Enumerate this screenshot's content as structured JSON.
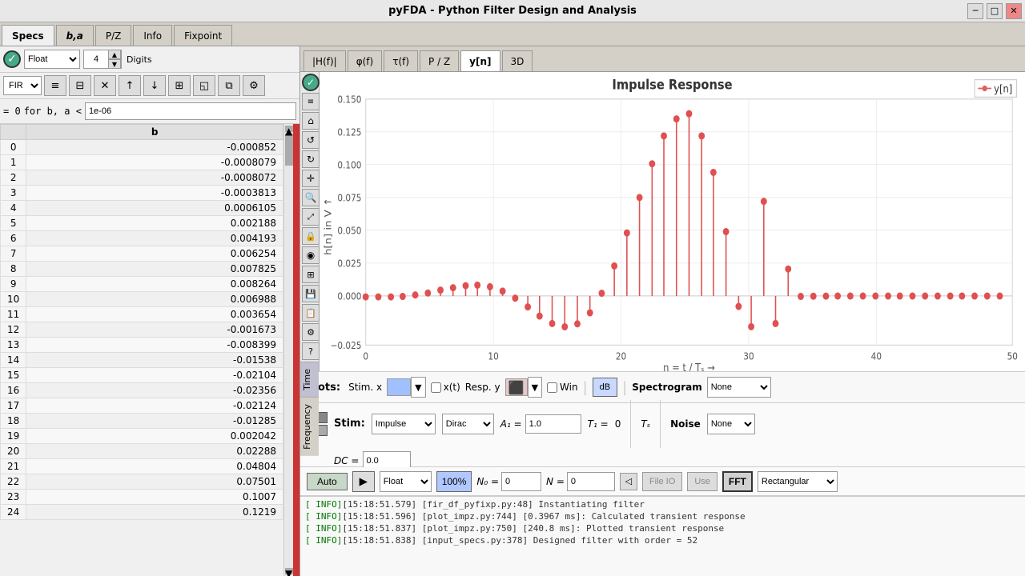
{
  "titlebar": {
    "title": "pyFDA - Python Filter Design and Analysis",
    "controls": [
      "minimize",
      "maximize",
      "close"
    ]
  },
  "top_tabs": [
    {
      "label": "Specs",
      "active": true,
      "bold": false
    },
    {
      "label": "b,a",
      "active": false,
      "bold": true
    },
    {
      "label": "P/Z",
      "active": false,
      "bold": false
    },
    {
      "label": "Info",
      "active": false,
      "bold": false
    },
    {
      "label": "Fixpoint",
      "active": false,
      "bold": false
    }
  ],
  "toolbar": {
    "float_label": "Float",
    "digits_value": "4",
    "digits_label": "Digits",
    "filter_type": "FIR"
  },
  "filter_expr": {
    "prefix": "= 0",
    "for_label": "for b, a <",
    "threshold": "1e-06"
  },
  "coeff_table": {
    "col_b": "b",
    "rows": [
      {
        "idx": 0,
        "b": "-0.000852"
      },
      {
        "idx": 1,
        "b": "-0.0008079"
      },
      {
        "idx": 2,
        "b": "-0.0008072"
      },
      {
        "idx": 3,
        "b": "-0.0003813"
      },
      {
        "idx": 4,
        "b": "0.0006105"
      },
      {
        "idx": 5,
        "b": "0.002188"
      },
      {
        "idx": 6,
        "b": "0.004193"
      },
      {
        "idx": 7,
        "b": "0.006254"
      },
      {
        "idx": 8,
        "b": "0.007825"
      },
      {
        "idx": 9,
        "b": "0.008264"
      },
      {
        "idx": 10,
        "b": "0.006988"
      },
      {
        "idx": 11,
        "b": "0.003654"
      },
      {
        "idx": 12,
        "b": "-0.001673"
      },
      {
        "idx": 13,
        "b": "-0.008399"
      },
      {
        "idx": 14,
        "b": "-0.01538"
      },
      {
        "idx": 15,
        "b": "-0.02104"
      },
      {
        "idx": 16,
        "b": "-0.02356"
      },
      {
        "idx": 17,
        "b": "-0.02124"
      },
      {
        "idx": 18,
        "b": "-0.01285"
      },
      {
        "idx": 19,
        "b": "0.002042"
      },
      {
        "idx": 20,
        "b": "0.02288"
      },
      {
        "idx": 21,
        "b": "0.04804"
      },
      {
        "idx": 22,
        "b": "0.07501"
      },
      {
        "idx": 23,
        "b": "0.1007"
      },
      {
        "idx": 24,
        "b": "0.1219"
      }
    ]
  },
  "plot_tabs": [
    {
      "label": "|H(f)|",
      "active": false
    },
    {
      "label": "φ(f)",
      "active": false
    },
    {
      "label": "τ(f)",
      "active": false
    },
    {
      "label": "P / Z",
      "active": false
    },
    {
      "label": "y[n]",
      "active": true
    },
    {
      "label": "3D",
      "active": false
    }
  ],
  "side_buttons": [
    {
      "label": "Time",
      "active": true
    },
    {
      "label": "Frequency",
      "active": false
    }
  ],
  "chart": {
    "title": "Impulse Response",
    "legend": "y[n]",
    "x_axis_label": "n = t / Tₛ →",
    "y_axis_label": "h[n] in V ↑",
    "x_min": 0,
    "x_max": 50,
    "y_min": -0.025,
    "y_max": 0.15
  },
  "chart_toolbar": {
    "plots_label": "Plots:",
    "stim_x_label": "Stim. x",
    "xt_label": "x(t)",
    "resp_y_label": "Resp. y",
    "win_label": "Win",
    "db_label": "dB",
    "spectrogram_label": "Spectrogram",
    "spectrogram_option": "None"
  },
  "stim_section": {
    "label": "Stim:",
    "type": "Impulse",
    "subtype": "Dirac",
    "a1_label": "A₁ =",
    "a1_value": "1.0",
    "t1_label": "T₁ =",
    "t1_value": "0",
    "ts_label": "Tₛ",
    "noise_label": "Noise",
    "noise_value": "None",
    "dc_label": "DC =",
    "dc_value": "0.0"
  },
  "bottom_controls": {
    "auto_label": "Auto",
    "play_icon": "▶",
    "float_label": "Float",
    "percent_label": "100%",
    "n0_label": "N₀ =",
    "n0_value": "0",
    "n_label": "N =",
    "n_value": "0",
    "file_io_label": "File IO",
    "use_label": "Use",
    "fft_label": "FFT",
    "rect_label": "Rectangular"
  },
  "log_lines": [
    {
      "text": "[ INFO][15:18:51.579] [fir_df_pyfixp.py:48] Instantiating filter"
    },
    {
      "text": "[ INFO][15:18:51.596] [plot_impz.py:744] [0.3967 ms]: Calculated transient response"
    },
    {
      "text": "[ INFO][15:18:51.837] [plot_impz.py:750] [240.8 ms]: Plotted transient response"
    },
    {
      "text": "[ INFO][15:18:51.838] [input_specs.py:378] Designed filter with order = 52"
    }
  ],
  "toolbar2_buttons": [
    {
      "icon": "≡",
      "title": "list"
    },
    {
      "icon": "⊟",
      "title": "filter"
    },
    {
      "icon": "✕",
      "title": "delete"
    },
    {
      "icon": "↑",
      "title": "move-up"
    },
    {
      "icon": "↓",
      "title": "move-down"
    },
    {
      "icon": "⊡",
      "title": "grid"
    },
    {
      "icon": "◱",
      "title": "load"
    },
    {
      "icon": "⚙",
      "title": "settings"
    }
  ]
}
